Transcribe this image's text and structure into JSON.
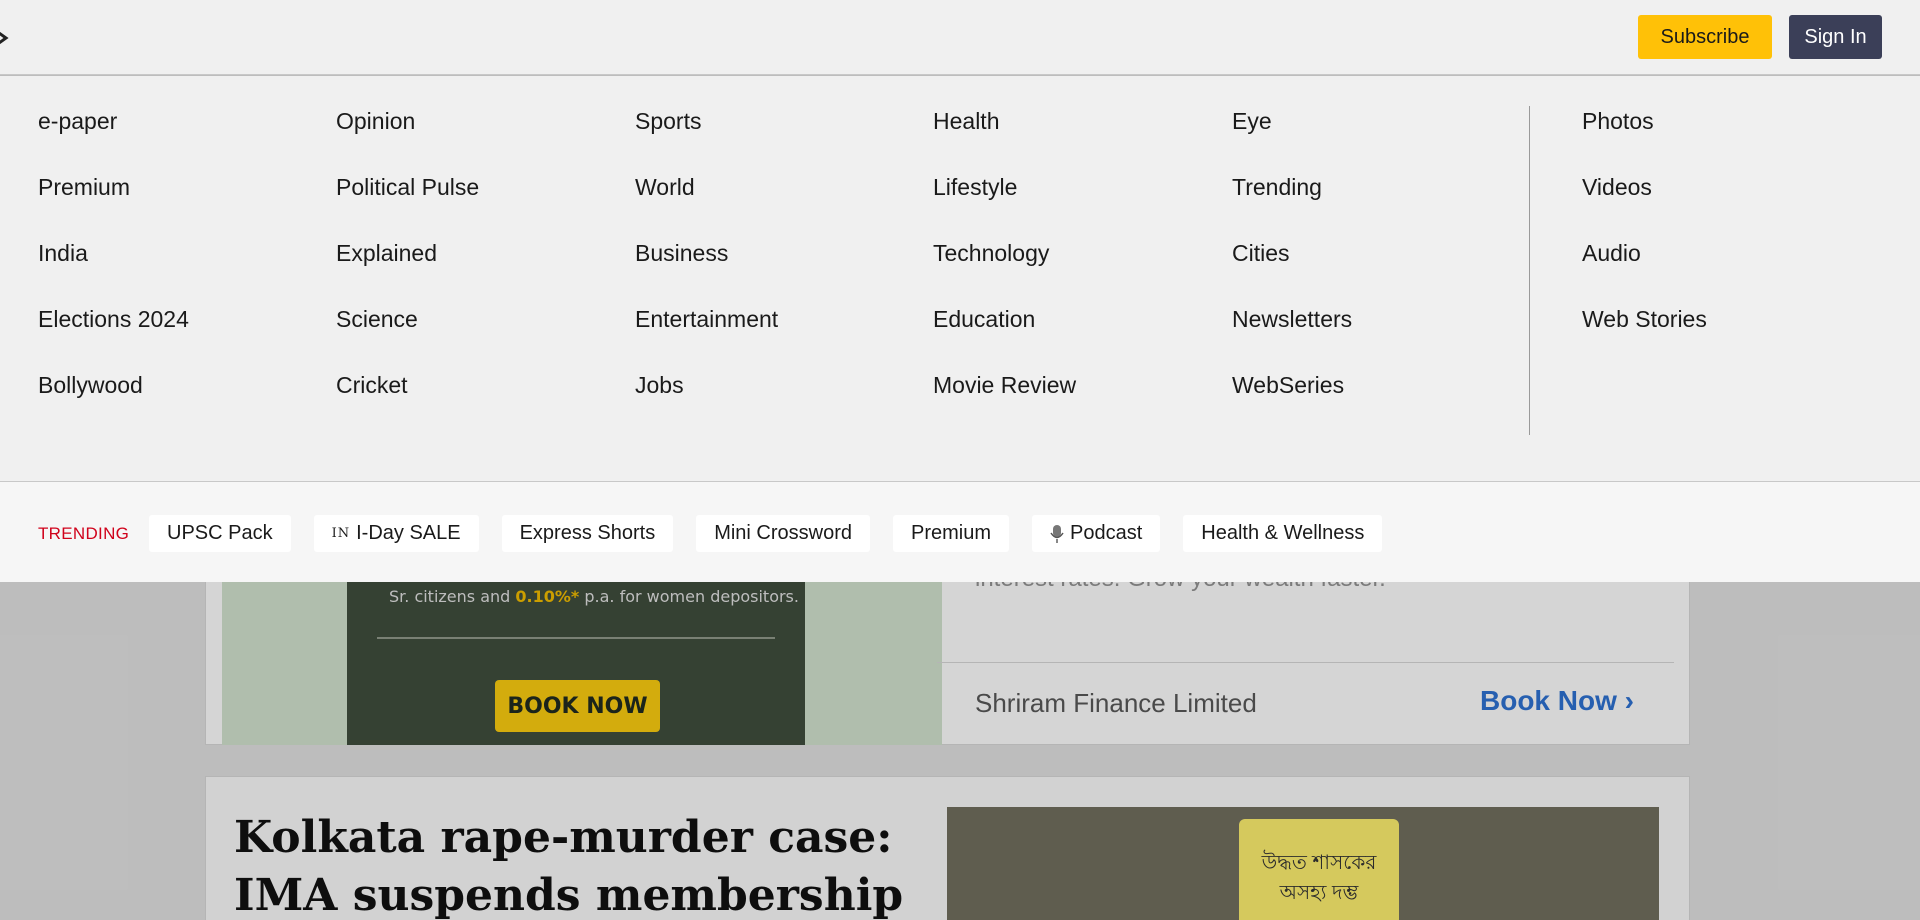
{
  "header": {
    "subscribe_label": "Subscribe",
    "signin_label": "Sign In"
  },
  "menu": {
    "columns": [
      [
        "e-paper",
        "Premium",
        "India",
        "Elections 2024",
        "Bollywood"
      ],
      [
        "Opinion",
        "Political Pulse",
        "Explained",
        "Science",
        "Cricket"
      ],
      [
        "Sports",
        "World",
        "Business",
        "Entertainment",
        "Jobs"
      ],
      [
        "Health",
        "Lifestyle",
        "Technology",
        "Education",
        "Movie Review"
      ],
      [
        "Eye",
        "Trending",
        "Cities",
        "Newsletters",
        "WebSeries"
      ],
      [
        "Photos",
        "Videos",
        "Audio",
        "Web Stories"
      ]
    ]
  },
  "trending": {
    "label": "TRENDING",
    "chips": [
      {
        "label": "UPSC Pack"
      },
      {
        "prefix": "IN",
        "label": "I-Day SALE"
      },
      {
        "label": "Express Shorts"
      },
      {
        "label": "Mini Crossword"
      },
      {
        "label": "Premium"
      },
      {
        "icon": "microphone-icon",
        "label": "Podcast"
      },
      {
        "label": "Health & Wellness"
      }
    ]
  },
  "ad": {
    "small_text_pre": "Sr. citizens and ",
    "small_text_highlight": "0.10%*",
    "small_text_post": " p.a. for women depositors.",
    "image_cta": "BOOK NOW",
    "body_text": "interest rates. Grow your wealth faster.",
    "advertiser": "Shriram Finance Limited",
    "cta": "Book Now"
  },
  "story": {
    "title": "Kolkata rape-murder case: IMA suspends membership",
    "sign_text": "উদ্ধত শাসকের অসহ্য দম্ভ"
  },
  "colors": {
    "subscribe_bg": "#ffc107",
    "signin_bg": "#3b3f58",
    "trending_label": "#d0021b",
    "link_blue": "#2c6dc9"
  }
}
